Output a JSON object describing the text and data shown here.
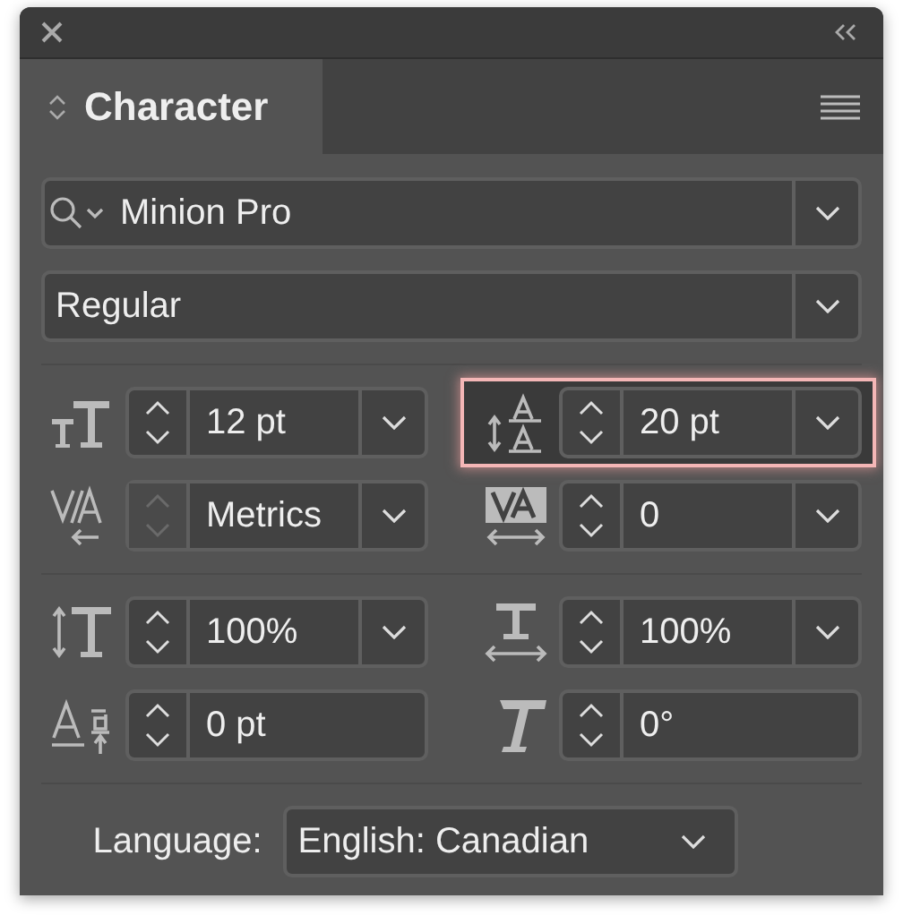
{
  "tab": {
    "label": "Character",
    "selected": true
  },
  "font_family": {
    "value": "Minion Pro"
  },
  "font_style": {
    "value": "Regular"
  },
  "sections": [
    {
      "controls": [
        {
          "kind": "combo",
          "value": "12 pt",
          "highlighted": false,
          "stepper_disabled": false
        },
        {
          "kind": "combo",
          "value": "20 pt",
          "highlighted": true,
          "stepper_disabled": false
        },
        {
          "kind": "combo",
          "value": "Metrics",
          "highlighted": false,
          "stepper_disabled": true
        },
        {
          "kind": "combo",
          "value": "0",
          "highlighted": false,
          "stepper_disabled": false
        }
      ]
    },
    {
      "controls": [
        {
          "kind": "combo",
          "value": "100%",
          "highlighted": false,
          "stepper_disabled": false
        },
        {
          "kind": "combo",
          "value": "100%",
          "highlighted": false,
          "stepper_disabled": false
        },
        {
          "kind": "field",
          "value": "0 pt",
          "highlighted": false,
          "stepper_disabled": false
        },
        {
          "kind": "field",
          "value": "0°",
          "highlighted": false,
          "stepper_disabled": false
        }
      ]
    }
  ],
  "language": {
    "label": "Language:",
    "value": "English: Canadian"
  }
}
